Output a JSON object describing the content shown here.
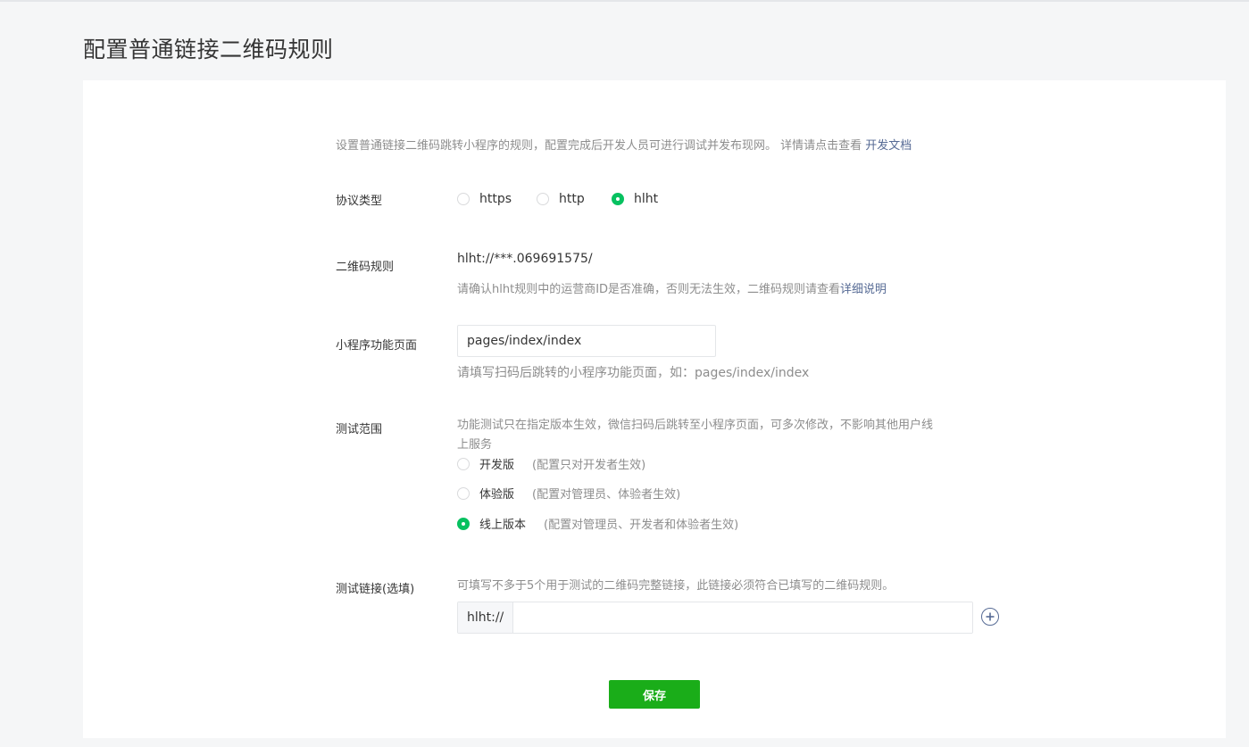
{
  "page": {
    "title": "配置普通链接二维码规则"
  },
  "intro": {
    "text": "设置普通链接二维码跳转小程序的规则，配置完成后开发人员可进行调试并发布现网。 详情请点击查看 ",
    "link": "开发文档"
  },
  "protocol": {
    "label": "协议类型",
    "options": [
      {
        "label": "https",
        "checked": false
      },
      {
        "label": "http",
        "checked": false
      },
      {
        "label": "hlht",
        "checked": true
      }
    ]
  },
  "qr_rule": {
    "label": "二维码规则",
    "value": "hlht://***.069691575/",
    "note": "请确认hlht规则中的运营商ID是否准确，否则无法生效，二维码规则请查看",
    "note_link": "详细说明"
  },
  "page_path": {
    "label": "小程序功能页面",
    "value": "pages/index/index",
    "note": "请填写扫码后跳转的小程序功能页面，如：pages/index/index"
  },
  "test_scope": {
    "label": "测试范围",
    "desc_line1": "功能测试只在指定版本生效，微信扫码后跳转至小程序页面，可多次修改，不影响其他用户线",
    "desc_line2": "上服务",
    "options": [
      {
        "label": "开发版",
        "note": "(配置只对开发者生效)",
        "checked": false
      },
      {
        "label": "体验版",
        "note": "(配置对管理员、体验者生效)",
        "checked": false
      },
      {
        "label": "线上版本",
        "note": "(配置对管理员、开发者和体验者生效)",
        "checked": true
      }
    ]
  },
  "test_link": {
    "label": "测试链接(选填)",
    "desc": "可填写不多于5个用于测试的二维码完整链接，此链接必须符合已填写的二维码规则。",
    "prefix": "hlht://",
    "value": "",
    "add_icon": "plus-circle-icon"
  },
  "actions": {
    "save_label": "保存"
  },
  "colors": {
    "accent": "#07c160",
    "button": "#1aad19",
    "link": "#576b95"
  }
}
